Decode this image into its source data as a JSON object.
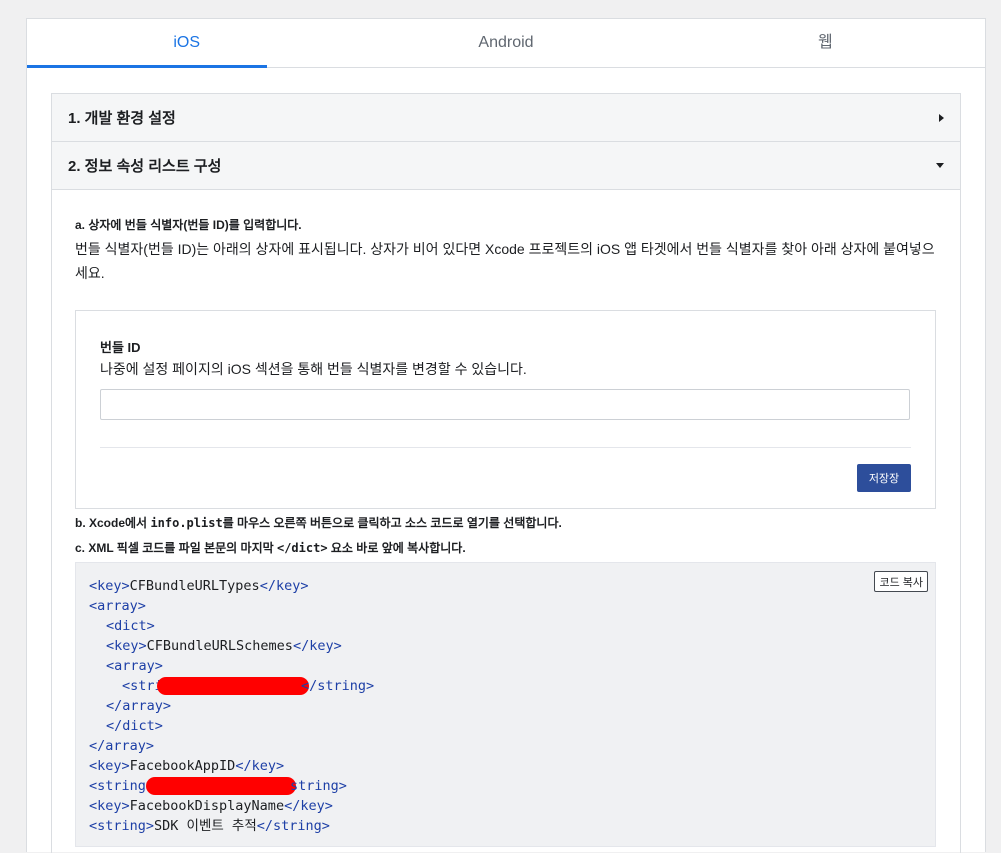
{
  "tabs": [
    {
      "label": "iOS",
      "active": true
    },
    {
      "label": "Android",
      "active": false
    },
    {
      "label": "웹",
      "active": false
    }
  ],
  "sections": {
    "s1_title": "1. 개발 환경 설정",
    "s2_title": "2. 정보 속성 리스트 구성"
  },
  "step_a": {
    "title": "a. 상자에 번들 식별자(번들 ID)를 입력합니다.",
    "description": "번들 식별자(번들 ID)는 아래의 상자에 표시됩니다. 상자가 비어 있다면 Xcode 프로젝트의 iOS 앱 타겟에서 번들 식별자를 찾아 아래 상자에 붙여넣으세요."
  },
  "bundle": {
    "label": "번들 ID",
    "hint": "나중에 설정 페이지의 iOS 섹션을 통해 번들 식별자를 변경할 수 있습니다.",
    "value": "",
    "save_label": "저장장"
  },
  "step_b": {
    "prefix": "b. Xcode에서 ",
    "code": "info.plist",
    "suffix": "를 마우스 오른쪽 버튼으로 클릭하고 소스 코드로 열기를 선택합니다."
  },
  "step_c": {
    "prefix": "c. XML 픽셀 코드를 파일 본문의 마지막 ",
    "code": "</dict>",
    "suffix": " 요소 바로 앞에 복사합니다."
  },
  "code": {
    "copy_label": "코드 복사",
    "l1_open": "<key>",
    "l1_text": "CFBundleURLTypes",
    "l1_close": "</key>",
    "l2": "<array>",
    "l3": "<dict>",
    "l4_open": "<key>",
    "l4_text": "CFBundleURLSchemes",
    "l4_close": "</key>",
    "l5": "<array>",
    "l6_open": "<string>",
    "l6_close": "</string>",
    "l7": "</array>",
    "l8": "</dict>",
    "l9": "</array>",
    "l10_open": "<key>",
    "l10_text": "FacebookAppID",
    "l10_close": "</key>",
    "l11_open": "<string>",
    "l11_close": "string>",
    "l12_open": "<key>",
    "l12_text": "FacebookDisplayName",
    "l12_close": "</key>",
    "l13_open": "<string>",
    "l13_text": "SDK 이벤트 추적",
    "l13_close": "</string>"
  },
  "colors": {
    "accent": "#1b74e4",
    "save_button": "#2d4e9b",
    "redaction": "#ff0000",
    "xml_tag": "#1d3fa6"
  }
}
